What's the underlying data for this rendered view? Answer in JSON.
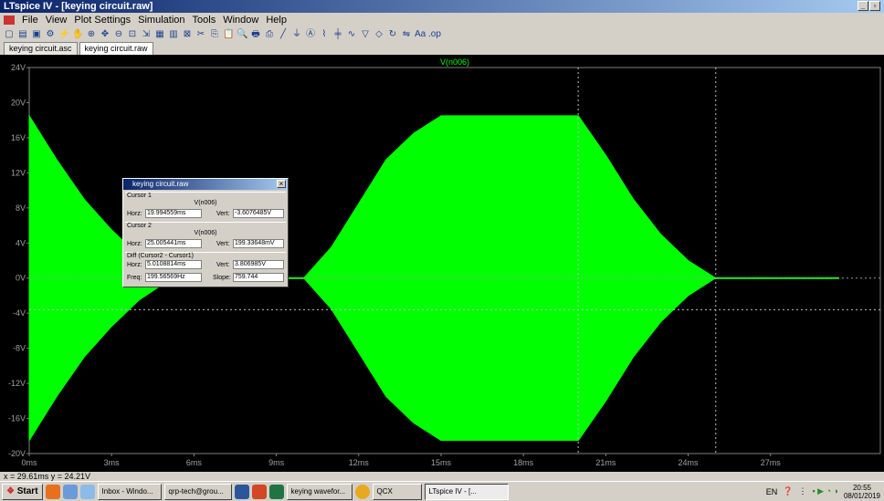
{
  "window": {
    "title": "LTspice IV - [keying circuit.raw]"
  },
  "menu": [
    "File",
    "View",
    "Plot Settings",
    "Simulation",
    "Tools",
    "Window",
    "Help"
  ],
  "tabs": [
    {
      "label": "keying circuit.asc"
    },
    {
      "label": "keying circuit.raw"
    }
  ],
  "plot": {
    "trace_label": "V(n006)",
    "trace_color": "#00ff00",
    "background": "#000000"
  },
  "chart_data": {
    "type": "area",
    "series": [
      {
        "name": "V(n006)",
        "x": [
          0,
          1,
          2,
          3,
          4,
          5.2,
          10,
          11,
          12,
          13,
          14,
          15,
          20,
          21,
          22,
          23,
          24,
          25,
          29.5
        ],
        "upper": [
          18.5,
          13.5,
          9,
          5.5,
          2.5,
          0,
          0,
          3.5,
          8.5,
          13.5,
          16.5,
          18.5,
          18.5,
          14,
          9,
          5,
          2,
          0,
          0
        ],
        "lower": [
          -18.5,
          -13.5,
          -9,
          -5.5,
          -2.5,
          0,
          0,
          -3.5,
          -8.5,
          -13.5,
          -16.5,
          -18.5,
          -18.5,
          -14,
          -9,
          -5,
          -2,
          0,
          0
        ]
      }
    ],
    "xlim": [
      0,
      31
    ],
    "ylim": [
      -20,
      24
    ],
    "x_ticks": [
      "0ms",
      "3ms",
      "6ms",
      "9ms",
      "12ms",
      "15ms",
      "18ms",
      "21ms",
      "24ms",
      "27ms"
    ],
    "y_ticks": [
      "24V",
      "20V",
      "16V",
      "12V",
      "8V",
      "4V",
      "0V",
      "-4V",
      "-8V",
      "-12V",
      "-16V",
      "-20V"
    ],
    "cursors": {
      "x": [
        19.994559,
        25.005441
      ],
      "y": [
        -3.6076485
      ]
    },
    "grid": true
  },
  "cursor_dialog": {
    "title": "keying circuit.raw",
    "cursor1": {
      "label": "Cursor 1",
      "signal": "V(n006)",
      "horz_label": "Horz:",
      "horz": "19.994559ms",
      "vert_label": "Vert:",
      "vert": "-3.6076485V"
    },
    "cursor2": {
      "label": "Cursor 2",
      "signal": "V(n006)",
      "horz_label": "Horz:",
      "horz": "25.005441ms",
      "vert_label": "Vert:",
      "vert": "199.33648mV"
    },
    "diff": {
      "label": "Diff (Cursor2 - Cursor1)",
      "horz_label": "Horz:",
      "horz": "5.0108814ms",
      "vert_label": "Vert:",
      "vert": "3.806985V",
      "freq_label": "Freq:",
      "freq": "199.56569Hz",
      "slope_label": "Slope:",
      "slope": "759.744"
    }
  },
  "status": {
    "text": "x = 29.61ms   y = 24.21V"
  },
  "taskbar": {
    "start": "Start",
    "items": [
      "Inbox - Windo...",
      "qrp-tech@grou...",
      "keying wavefor...",
      "QCX",
      "LTspice IV - [..."
    ],
    "lang": "EN",
    "time": "20:55",
    "date": "08/01/2019"
  }
}
